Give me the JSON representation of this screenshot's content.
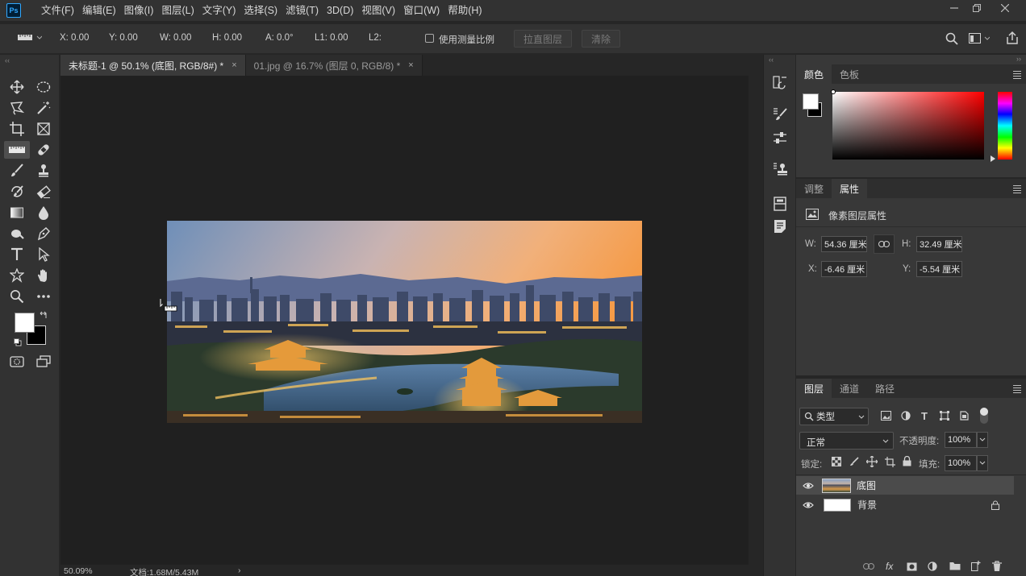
{
  "app": {
    "logo": "Ps"
  },
  "menu": [
    "文件(F)",
    "编辑(E)",
    "图像(I)",
    "图层(L)",
    "文字(Y)",
    "选择(S)",
    "滤镜(T)",
    "3D(D)",
    "视图(V)",
    "窗口(W)",
    "帮助(H)"
  ],
  "window_controls": [
    "minimize-icon",
    "restore-icon",
    "close-icon"
  ],
  "options": {
    "x": "X: 0.00",
    "y": "Y: 0.00",
    "w": "W: 0.00",
    "h": "H: 0.00",
    "a": "A: 0.0°",
    "l1": "L1: 0.00",
    "l2": "L2:",
    "use_scale": "使用测量比例",
    "straighten": "拉直图层",
    "clear": "清除"
  },
  "tabs": [
    {
      "label": "未标题-1 @ 50.1% (底图, RGB/8#) *",
      "active": true
    },
    {
      "label": "01.jpg @ 16.7% (图层 0, RGB/8) *",
      "active": false
    }
  ],
  "status": {
    "zoom": "50.09%",
    "doc": "文档:1.68M/5.43M",
    "arrow": "›"
  },
  "color_panel": {
    "tabs": [
      "颜色",
      "色板"
    ],
    "active": 0,
    "foreground": "#ffffff",
    "background": "#000000",
    "hue": "#ff0000"
  },
  "props_panel": {
    "tabs": [
      "调整",
      "属性"
    ],
    "active": 1,
    "heading": "像素图层属性",
    "w_label": "W:",
    "w_value": "54.36 厘米",
    "h_label": "H:",
    "h_value": "32.49 厘米",
    "x_label": "X:",
    "x_value": "-6.46 厘米",
    "y_label": "Y:",
    "y_value": "-5.54 厘米"
  },
  "layers_panel": {
    "tabs": [
      "图层",
      "通道",
      "路径"
    ],
    "active": 0,
    "filter": "类型",
    "blend_mode": "正常",
    "opacity_label": "不透明度:",
    "opacity": "100%",
    "lock_label": "锁定:",
    "fill_label": "填充:",
    "fill": "100%",
    "layers": [
      {
        "name": "底图",
        "selected": true,
        "visible": true,
        "locked": false
      },
      {
        "name": "背景",
        "selected": false,
        "visible": true,
        "locked": true
      }
    ]
  },
  "colors": {
    "accent": "#31a8ff",
    "chrome": "#323232",
    "panel": "#383838",
    "canvas_bg": "#202020"
  }
}
